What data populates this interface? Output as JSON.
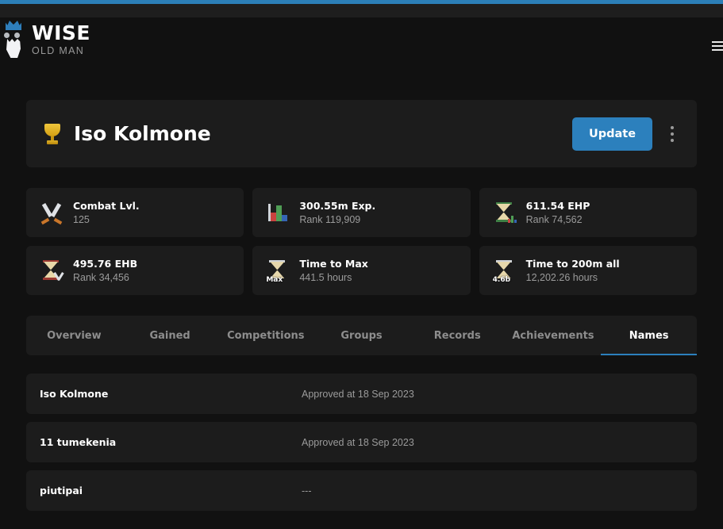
{
  "theme": {
    "accent": "#2c7fb8",
    "page_bg": "#111111",
    "card_bg": "#1c1c1c",
    "muted_text": "#9b9b9b"
  },
  "brand": {
    "title": "WISE",
    "subtitle": "OLD MAN",
    "logo_icon": "wise-old-man-logo"
  },
  "topnav": {
    "menu_icon": "hamburger-icon"
  },
  "player": {
    "name": "Iso Kolmone",
    "icon": "trophy-icon",
    "update_label": "Update",
    "menu_icon": "kebab-menu-icon"
  },
  "stats": [
    {
      "icon": "crossed-swords-icon",
      "label": "Combat Lvl.",
      "value": "125"
    },
    {
      "icon": "bar-chart-icon",
      "label": "300.55m Exp.",
      "value": "Rank 119,909"
    },
    {
      "icon": "hourglass-ehp-icon",
      "label": "611.54 EHP",
      "value": "Rank 74,562"
    },
    {
      "icon": "hourglass-ehb-icon",
      "label": "495.76 EHB",
      "value": "Rank 34,456"
    },
    {
      "icon": "hourglass-max-icon",
      "badge": "Max",
      "label": "Time to Max",
      "value": "441.5 hours"
    },
    {
      "icon": "hourglass-200m-icon",
      "badge": "4.6b",
      "label": "Time to 200m all",
      "value": "12,202.26 hours"
    }
  ],
  "tabs": [
    {
      "label": "Overview",
      "active": false
    },
    {
      "label": "Gained",
      "active": false
    },
    {
      "label": "Competitions",
      "active": false
    },
    {
      "label": "Groups",
      "active": false
    },
    {
      "label": "Records",
      "active": false
    },
    {
      "label": "Achievements",
      "active": false
    },
    {
      "label": "Names",
      "active": true
    }
  ],
  "names": [
    {
      "name": "Iso Kolmone",
      "status": "Approved at 18 Sep 2023"
    },
    {
      "name": "11 tumekenia",
      "status": "Approved at 18 Sep 2023"
    },
    {
      "name": "piutipai",
      "status": "---"
    }
  ]
}
